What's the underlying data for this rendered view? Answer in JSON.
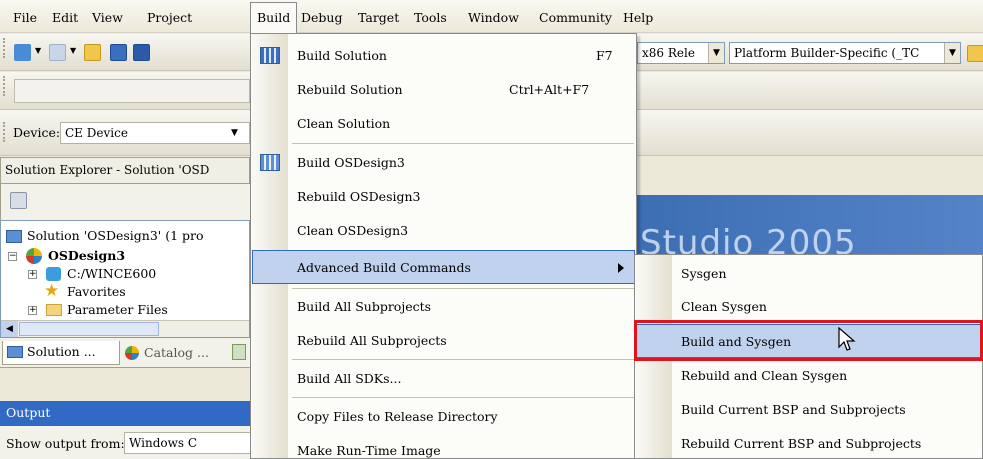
{
  "menubar": {
    "items": [
      "File",
      "Edit",
      "View",
      "Project",
      "Build",
      "Debug",
      "Target",
      "Tools",
      "Window",
      "Community",
      "Help"
    ]
  },
  "toolbar": {
    "config_combo": "x86 Rele",
    "platform_combo": "Platform Builder-Specific (_TC",
    "device_label": "Device:",
    "device_value": "CE Device"
  },
  "solution_explorer": {
    "title": "Solution Explorer - Solution 'OSD",
    "tree": [
      {
        "label": "Solution 'OSDesign3' (1 pro",
        "icon": "solution-icon"
      },
      {
        "label": "OSDesign3",
        "icon": "osdesign-icon"
      },
      {
        "label": "C:/WINCE600",
        "icon": "platform-icon"
      },
      {
        "label": "Favorites",
        "icon": "star-icon"
      },
      {
        "label": "Parameter Files",
        "icon": "folder-icon"
      }
    ],
    "tabs": [
      "Solution ...",
      "Catalog ..."
    ]
  },
  "output": {
    "title": "Output",
    "show_label": "Show output from:",
    "show_value": "Windows C"
  },
  "build_menu": {
    "items": [
      {
        "label": "Build Solution",
        "shortcut": "F7"
      },
      {
        "label": "Rebuild Solution",
        "shortcut": "Ctrl+Alt+F7"
      },
      {
        "label": "Clean Solution"
      },
      {
        "label": "Build OSDesign3"
      },
      {
        "label": "Rebuild OSDesign3"
      },
      {
        "label": "Clean OSDesign3"
      },
      {
        "label": "Advanced Build Commands"
      },
      {
        "label": "Build All Subprojects"
      },
      {
        "label": "Rebuild All Subprojects"
      },
      {
        "label": "Build All SDKs..."
      },
      {
        "label": "Copy Files to Release Directory"
      },
      {
        "label": "Make Run-Time Image"
      }
    ]
  },
  "submenu": {
    "items": [
      "Sysgen",
      "Clean Sysgen",
      "Build and Sysgen",
      "Rebuild and Clean Sysgen",
      "Build Current BSP and Subprojects",
      "Rebuild Current BSP and Subprojects"
    ]
  },
  "start_page": {
    "text": "Studio 2005"
  }
}
